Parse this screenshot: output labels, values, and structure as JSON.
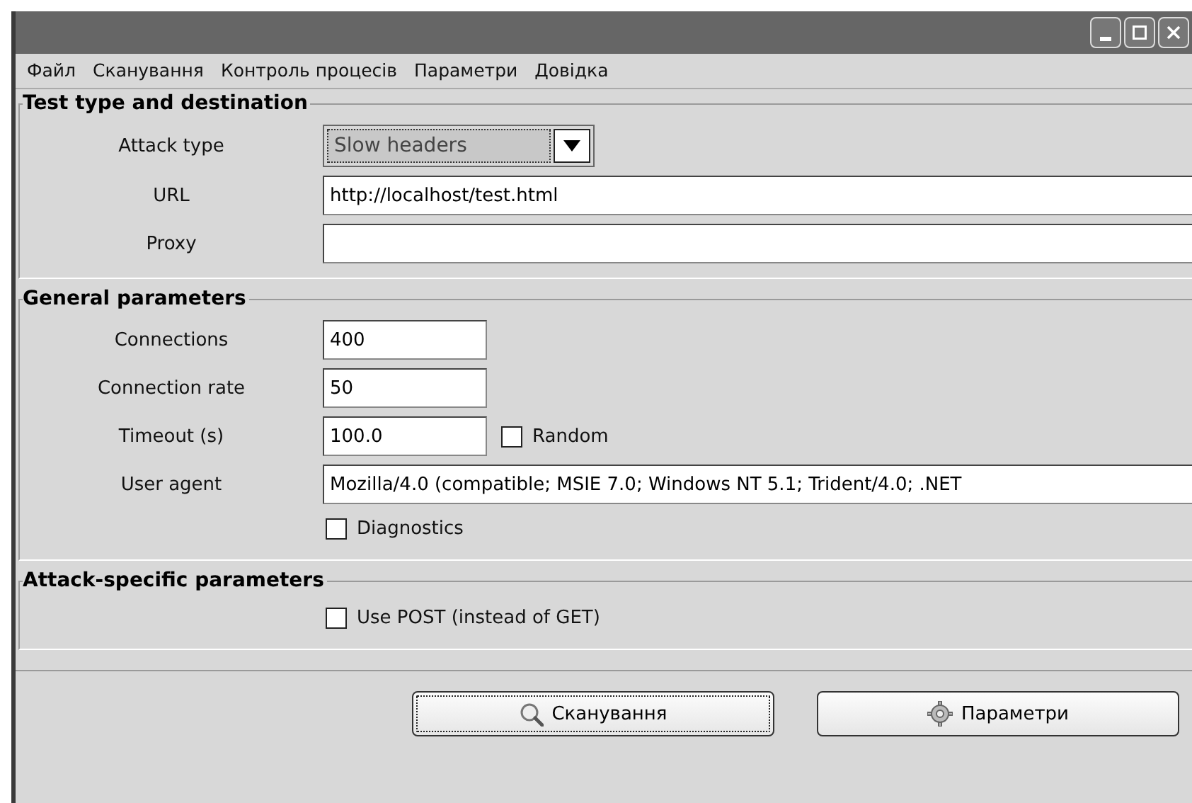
{
  "menu": [
    "Файл",
    "Сканування",
    "Контроль процесів",
    "Параметри",
    "Довідка"
  ],
  "groups": [
    {
      "title": "Test type and destination",
      "rows": [
        {
          "kind": "dropdown",
          "label": "Attack type",
          "value": "Slow headers"
        },
        {
          "kind": "field",
          "label": "URL",
          "value": "http://localhost/test.html"
        },
        {
          "kind": "field",
          "label": "Proxy",
          "value": ""
        }
      ]
    },
    {
      "title": "General parameters",
      "rows": [
        {
          "kind": "shortfield",
          "label": "Connections",
          "value": "400"
        },
        {
          "kind": "shortfield",
          "label": "Connection rate",
          "value": "50"
        },
        {
          "kind": "shortfield",
          "label": "Timeout (s)",
          "value": "100.0",
          "check": {
            "label": "Random",
            "checked": false
          }
        },
        {
          "kind": "field",
          "label": "User agent",
          "value": "Mozilla/4.0 (compatible; MSIE 7.0; Windows NT 5.1; Trident/4.0; .NET"
        },
        {
          "kind": "check",
          "label": "Diagnostics",
          "checked": false
        }
      ]
    },
    {
      "title": "Attack-specific parameters",
      "rows": [
        {
          "kind": "check",
          "label": "Use POST (instead of GET)",
          "checked": false
        }
      ]
    }
  ],
  "buttons": [
    {
      "label": "Сканування",
      "focused": true
    },
    {
      "label": "Параметри",
      "focused": false
    }
  ]
}
